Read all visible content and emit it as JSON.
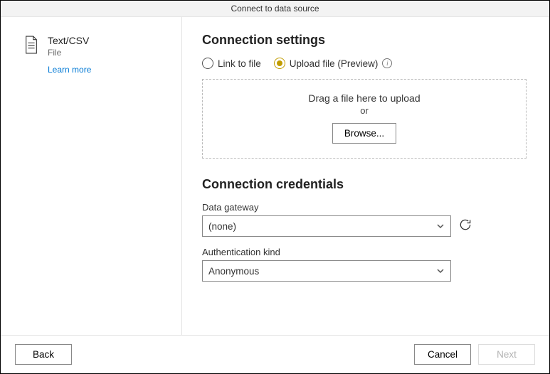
{
  "window": {
    "title": "Connect to data source"
  },
  "sidebar": {
    "source_title": "Text/CSV",
    "source_sub": "File",
    "learn_more": "Learn more"
  },
  "settings": {
    "heading": "Connection settings",
    "radio_link": "Link to file",
    "radio_upload": "Upload file (Preview)"
  },
  "dropzone": {
    "text": "Drag a file here to upload",
    "or": "or",
    "browse": "Browse..."
  },
  "credentials": {
    "heading": "Connection credentials",
    "gateway_label": "Data gateway",
    "gateway_value": "(none)",
    "auth_label": "Authentication kind",
    "auth_value": "Anonymous"
  },
  "footer": {
    "back": "Back",
    "cancel": "Cancel",
    "next": "Next"
  }
}
